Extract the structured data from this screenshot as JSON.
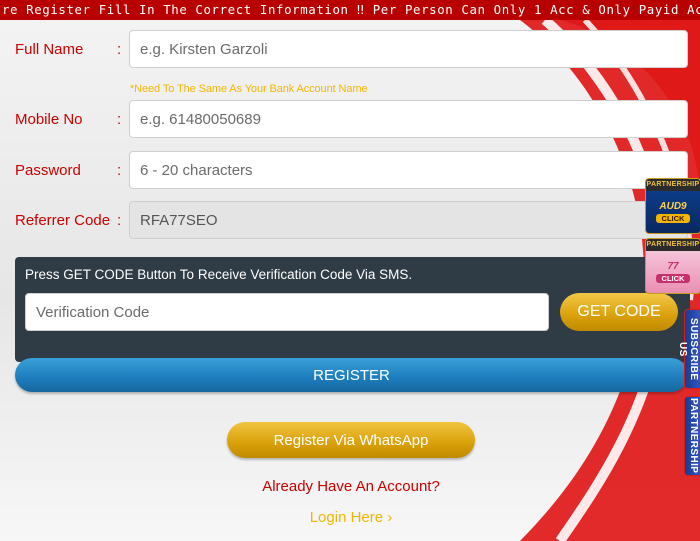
{
  "marquee": {
    "text": "re Register Fill In The Correct Information ‼ Per Person Can Only 1 Acc & Only Payid Account Is Allowed To Be"
  },
  "form": {
    "full_name": {
      "label": "Full Name",
      "colon": ":",
      "placeholder": "e.g. Kirsten Garzoli",
      "hint": "*Need To The Same As Your Bank Account Name"
    },
    "mobile": {
      "label": "Mobile No",
      "colon": ":",
      "placeholder": "e.g. 61480050689"
    },
    "password": {
      "label": "Password",
      "colon": ":",
      "placeholder": "6 - 20 characters"
    },
    "referrer": {
      "label": "Referrer Code",
      "colon": ":",
      "value": "RFA77SEO"
    }
  },
  "otp": {
    "instruction": "Press GET CODE Button To Receive Verification Code Via SMS.",
    "placeholder": "Verification Code",
    "button_label": "GET CODE"
  },
  "actions": {
    "register_label": "REGISTER",
    "whatsapp_label": "Register Via WhatsApp",
    "have_account_text": "Already Have An Account?",
    "login_label": "Login Here ›"
  },
  "side": {
    "badge_1": {
      "head": "PARTNERSHIP",
      "brand": "AUD9",
      "action": "CLICK"
    },
    "badge_2": {
      "head": "PARTNERSHIP",
      "brand": "77",
      "action": "CLICK"
    },
    "subscribe_tab": "SUBSCRIBE US",
    "partnership_tab": "PARTNERSHIP"
  },
  "colors": {
    "marquee_bg": "#b80000",
    "label_red": "#cc0000",
    "hint_gold": "#f2b600",
    "panel_dark": "#2f3b45",
    "register_blue": "#1f7fbf",
    "gold_button": "#d9a00a"
  }
}
